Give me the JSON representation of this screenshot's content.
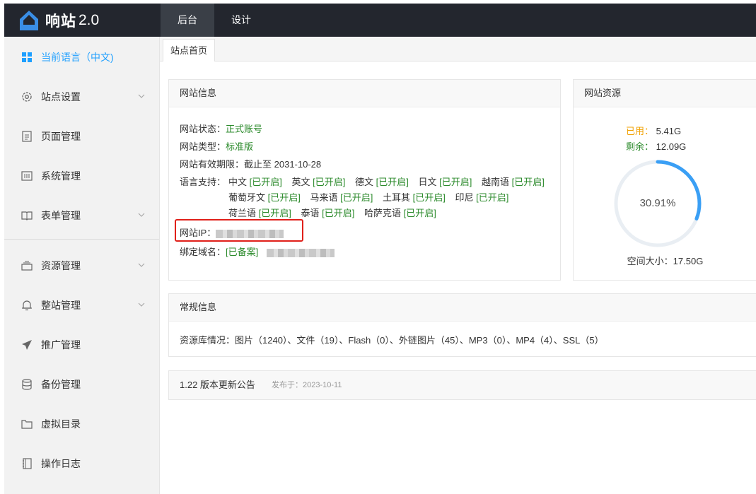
{
  "topbar": {
    "brand": "响站",
    "version": "2.0",
    "tabs": [
      "后台",
      "设计"
    ]
  },
  "sidebar": {
    "items": [
      {
        "label": "当前语言（中文)",
        "icon": "grid-icon",
        "active": true,
        "chevron": false
      },
      {
        "label": "站点设置",
        "icon": "gear-icon",
        "chevron": true
      },
      {
        "label": "页面管理",
        "icon": "page-icon",
        "chevron": false
      },
      {
        "label": "系统管理",
        "icon": "system-icon",
        "chevron": false
      },
      {
        "label": "表单管理",
        "icon": "book-icon",
        "chevron": true
      },
      {
        "label": "资源管理",
        "icon": "tray-icon",
        "chevron": true
      },
      {
        "label": "整站管理",
        "icon": "bell-icon",
        "chevron": true
      },
      {
        "label": "推广管理",
        "icon": "send-icon",
        "chevron": false
      },
      {
        "label": "备份管理",
        "icon": "database-icon",
        "chevron": false
      },
      {
        "label": "虚拟目录",
        "icon": "folder-icon",
        "chevron": false
      },
      {
        "label": "操作日志",
        "icon": "log-icon",
        "chevron": false
      }
    ]
  },
  "breadcrumb": {
    "home": "站点首页"
  },
  "info": {
    "title": "网站信息",
    "status_label": "网站状态：",
    "status_value": "正式账号",
    "type_label": "网站类型：",
    "type_value": "标准版",
    "expiry_label": "网站有效期限：",
    "expiry_value": "截止至 2031-10-28",
    "lang_label": "语言支持：",
    "enabled_text": "[已开启]",
    "langs_row1": [
      "中文",
      "英文",
      "德文",
      "日文",
      "越南语"
    ],
    "langs_row2": [
      "葡萄牙文",
      "马来语",
      "土耳其",
      "印尼"
    ],
    "langs_row3": [
      "荷兰语",
      "泰语",
      "哈萨克语"
    ],
    "ip_label": "网站IP：",
    "domain_label": "绑定域名：",
    "domain_status": "[已备案]"
  },
  "resources": {
    "title": "网站资源",
    "used_label": "已用：",
    "used_value": "5.41G",
    "left_label": "剩余：",
    "left_value": "12.09G",
    "percent_text": "30.91%",
    "percent": 30.91,
    "total_label": "空间大小：",
    "total_value": "17.50G",
    "ring_color": "#3a9ff5"
  },
  "general": {
    "title": "常规信息",
    "text": "资源库情况：图片（1240）、文件（19）、Flash（0）、外链图片（45）、MP3（0）、MP4（4）、SSL（5）"
  },
  "update": {
    "title": "1.22 版本更新公告",
    "date": "发布于：2023-10-11"
  }
}
